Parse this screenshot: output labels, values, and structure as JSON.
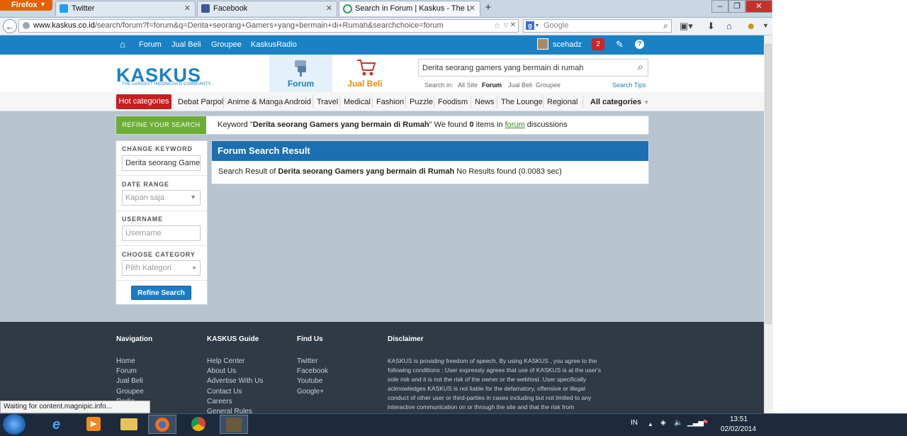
{
  "browser": {
    "app_button": "Firefox",
    "tabs": [
      {
        "label": "Twitter",
        "color": "#1da1f2"
      },
      {
        "label": "Facebook",
        "color": "#3b5998"
      },
      {
        "label": "Search in Forum | Kaskus - The Lar...",
        "color": "#26a65b"
      }
    ],
    "url_domain": "www.kaskus.co.id",
    "url_path": "/search/forum?f=forum&q=Derita+seorang+Gamers+yang+bermain+di+Rumah&searchchoice=forum",
    "search_engine_placeholder": "Google"
  },
  "topbar": {
    "links": [
      "Forum",
      "Jual Beli",
      "Groupee",
      "KaskusRadio"
    ],
    "username": "scehadz",
    "notification_count": "2"
  },
  "header": {
    "logo": "KASKUS",
    "logo_tagline": "THE LARGEST INDONESIAN COMMUNITY",
    "forum_tab": "Forum",
    "jualbeli_tab": "Jual Beli",
    "search_value": "Derita seorang gamers yang bermain di rumah",
    "search_in_label": "Search in:",
    "search_in_options": [
      "All Site",
      "Forum",
      "Jual Beli",
      "Groupee"
    ],
    "search_tips": "Search Tips"
  },
  "categories": {
    "hot": "Hot categories",
    "items": [
      "Debat Parpol",
      "Anime & Manga",
      "Android",
      "Travel",
      "Medical",
      "Fashion",
      "Puzzle",
      "Foodism",
      "News",
      "The Lounge",
      "Regional"
    ],
    "all": "All categories"
  },
  "refine": {
    "button": "REFINE YOUR SEARCH",
    "kw_prefix": "Keyword \"",
    "kw_term": "Derita seorang Gamers yang bermain di Rumah",
    "kw_mid": "\" We found ",
    "kw_count": "0",
    "kw_items": " items in ",
    "kw_link": "forum",
    "kw_suffix": " discussions"
  },
  "sidebar": {
    "change_keyword": "CHANGE KEYWORD",
    "keyword_value": "Derita seorang Gamers",
    "date_range": "DATE RANGE",
    "date_value": "Kapan saja",
    "username": "USERNAME",
    "username_placeholder": "Username",
    "category": "CHOOSE CATEGORY",
    "category_value": "Pilih Kategori",
    "submit": "Refine Search"
  },
  "result": {
    "title": "Forum Search Result",
    "prefix": "Search Result of ",
    "term": "Derita seorang Gamers yang bermain di Rumah",
    "suffix": " No Results found (0.0083 sec)"
  },
  "footer": {
    "nav_title": "Navigation",
    "nav_links": [
      "Home",
      "Forum",
      "Jual Beli",
      "Groupee",
      "Radio"
    ],
    "guide_title": "KASKUS Guide",
    "guide_links": [
      "Help Center",
      "About Us",
      "Advertise With Us",
      "Contact Us",
      "Careers",
      "General Rules"
    ],
    "find_title": "Find Us",
    "find_links": [
      "Twitter",
      "Facebook",
      "Youtube",
      "Google+"
    ],
    "disclaimer_title": "Disclaimer",
    "disclaimer_text": "KASKUS is providing freedom of speech. By using KASKUS , you agree to the following conditions ; User expressly agrees that use of KASKUS is at the user's sole risk and it is not the risk of the owner or the webhost. User specifically acknowledges KASKUS is not liable for the defamatory, offensive or illegal conduct of other user or third-parties in cases including but not limited to any interactive communication on or through the site and that the risk from"
  },
  "status_bar": "Waiting for content.magnipic.info...",
  "taskbar": {
    "lang": "IN",
    "time": "13:51",
    "date": "02/02/2014"
  }
}
